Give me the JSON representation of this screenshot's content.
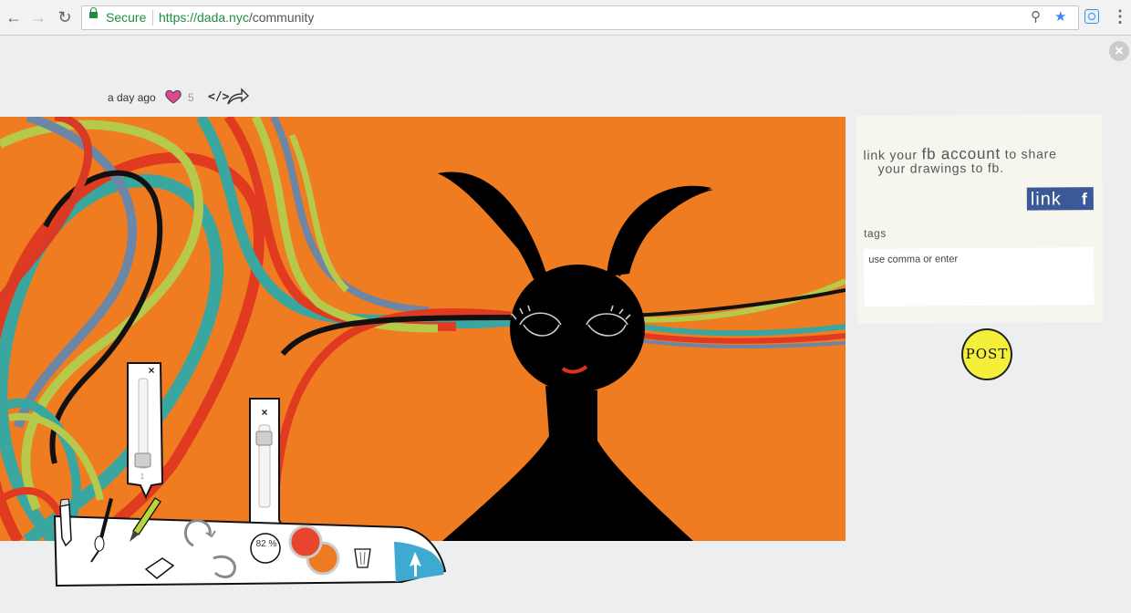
{
  "browser": {
    "security_label": "Secure",
    "url_host": "https://dada.nyc",
    "url_path": "/community"
  },
  "post": {
    "time": "a day ago",
    "likes": "5",
    "embed_label": "</>"
  },
  "panel": {
    "fb_text_1a": "link your ",
    "fb_text_1b": "fb account",
    "fb_text_1c": " to share",
    "fb_text_2": "your drawings to fb.",
    "link_label": "link",
    "fb_glyph": "f",
    "tags_label": "tags",
    "tags_placeholder": "use comma or enter",
    "post_label": "POST"
  },
  "toolbar": {
    "zoom_value": "82 %",
    "brush_size_value": "1",
    "primary_color": "#e8442e",
    "secondary_color": "#ee7b22",
    "go_color": "#3eaad1"
  },
  "icons": [
    "back-arrow-icon",
    "forward-arrow-icon",
    "reload-icon",
    "lock-icon",
    "zoom-icon",
    "star-icon",
    "extension-icon",
    "menu-icon",
    "close-icon",
    "heart-icon",
    "embed-icon",
    "share-icon",
    "pencil-icon",
    "brush-icon",
    "marker-icon",
    "eraser-icon",
    "redo-icon",
    "undo-icon",
    "trash-icon",
    "upload-arrow-icon"
  ]
}
